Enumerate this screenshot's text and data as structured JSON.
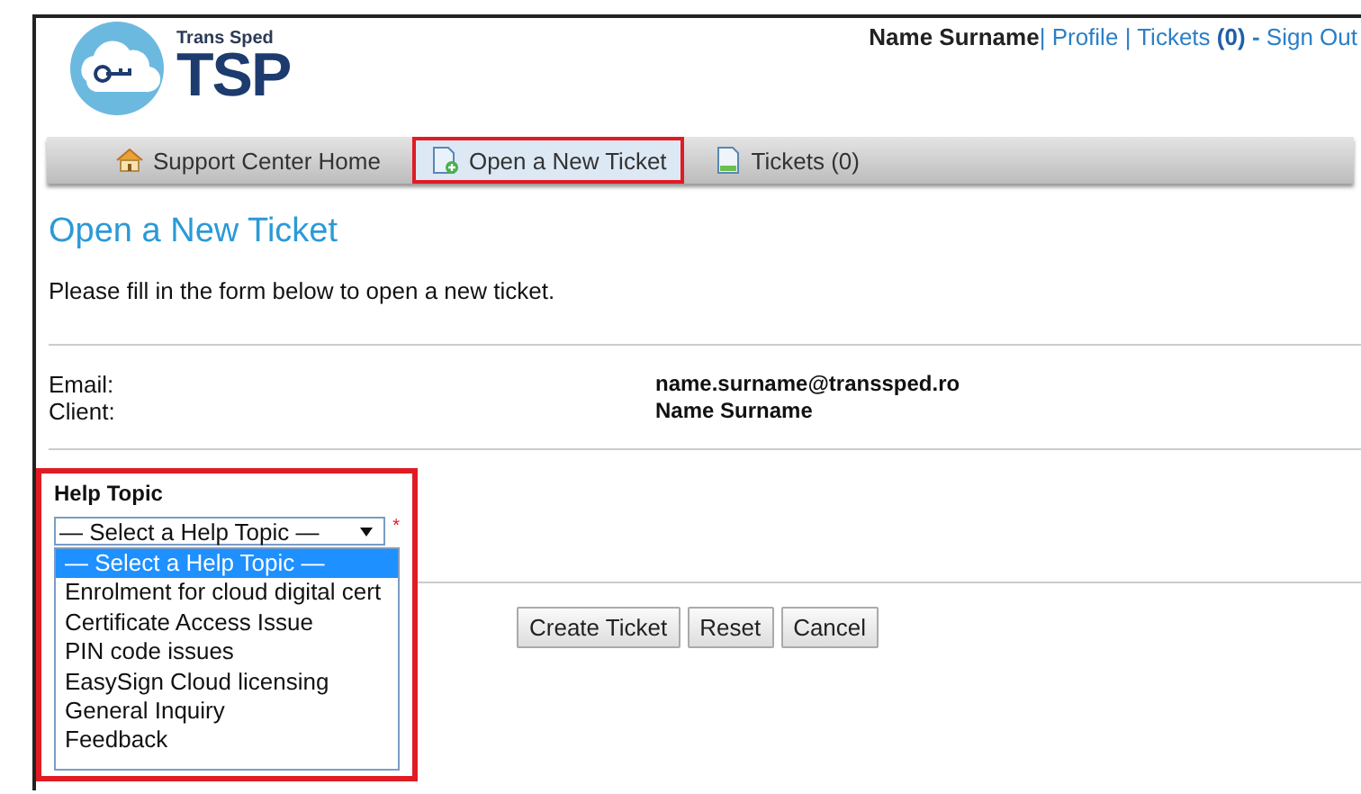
{
  "logo": {
    "brand": "Trans Sped",
    "mark": "TSP"
  },
  "user_bar": {
    "name": "Name Surname",
    "separator": "|",
    "profile": "Profile",
    "tickets": "Tickets",
    "ticket_count": "(0)",
    "dash": "-",
    "sign_out": "Sign Out"
  },
  "nav": [
    {
      "label": "Support Center Home",
      "kind": "home",
      "selected": false
    },
    {
      "label": "Open a New Ticket",
      "kind": "new",
      "selected": true
    },
    {
      "label": "Tickets (0)",
      "kind": "doc",
      "selected": false
    }
  ],
  "heading": "Open a New Ticket",
  "intro": "Please fill in the form below to open a new ticket.",
  "fields": [
    {
      "label": "Email:",
      "value": "name.surname@transsped.ro"
    },
    {
      "label": "Client:",
      "value": "Name Surname"
    }
  ],
  "help_topic": {
    "label": "Help Topic",
    "value": "— Select a Help Topic —",
    "required": "*",
    "expanded": true,
    "options": [
      {
        "label": "— Select a Help Topic —",
        "selected": true
      },
      {
        "label": "Enrolment for cloud digital cert",
        "selected": false
      },
      {
        "label": "Certificate Access Issue",
        "selected": false
      },
      {
        "label": "PIN code issues",
        "selected": false
      },
      {
        "label": "EasySign Cloud licensing",
        "selected": false
      },
      {
        "label": "General Inquiry",
        "selected": false
      },
      {
        "label": "Feedback",
        "selected": false
      }
    ]
  },
  "buttons": [
    "Create Ticket",
    "Reset",
    "Cancel"
  ]
}
